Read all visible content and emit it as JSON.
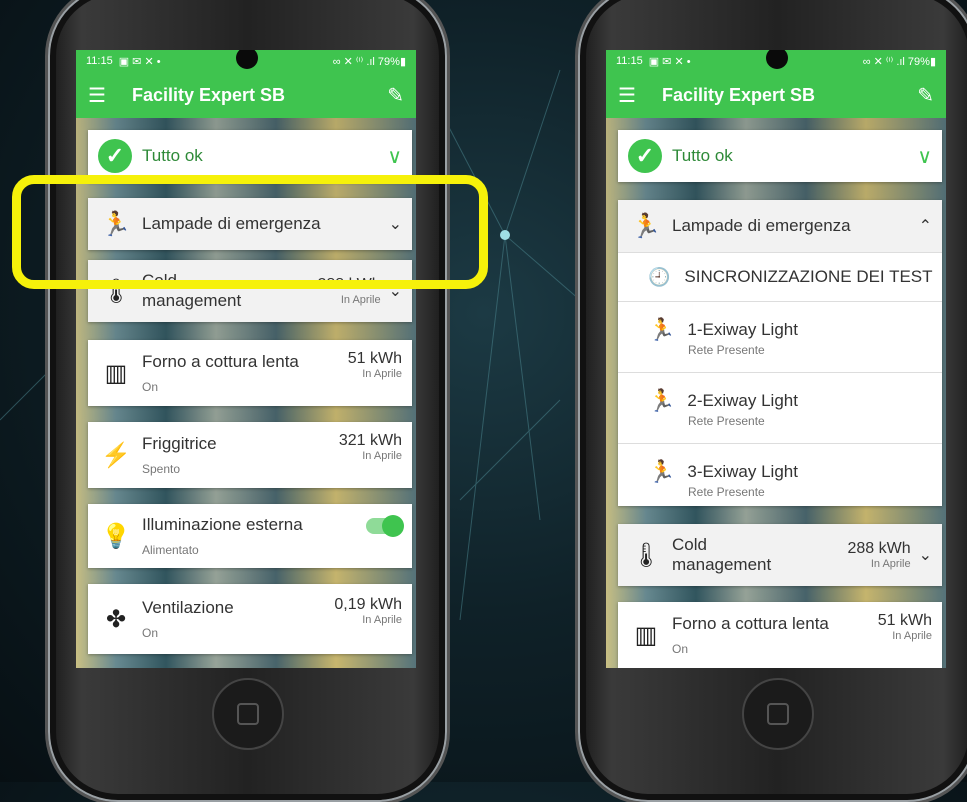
{
  "status_bar": {
    "time": "11:15",
    "icons": "▣ ✉ ✕ •",
    "right": "∞ ✕ ⁽ⁱ⁾ .ıl 79%▮"
  },
  "app": {
    "title": "Facility Expert SB"
  },
  "left": {
    "ok": "Tutto ok",
    "emergency": "Lampade di emergenza",
    "cold": {
      "label_1": "Cold",
      "label_2": "management",
      "value": "288 kWh",
      "meta": "In Aprile"
    },
    "oven": {
      "label": "Forno a cottura lenta",
      "value": "51 kWh",
      "meta": "In Aprile",
      "sub": "On"
    },
    "fryer": {
      "label": "Friggitrice",
      "value": "321 kWh",
      "meta": "In Aprile",
      "sub": "Spento"
    },
    "light": {
      "label": "Illuminazione esterna",
      "sub": "Alimentato"
    },
    "vent": {
      "label": "Ventilazione",
      "value": "0,19 kWh",
      "meta": "In Aprile",
      "sub": "On"
    }
  },
  "right": {
    "ok": "Tutto ok",
    "emergency": "Lampade di emergenza",
    "sync": "SINCRONIZZAZIONE DEI TEST",
    "items": [
      {
        "label": "1-Exiway Light",
        "sub": "Rete Presente"
      },
      {
        "label": "2-Exiway Light",
        "sub": "Rete Presente"
      },
      {
        "label": "3-Exiway Light",
        "sub": "Rete Presente"
      }
    ],
    "cold": {
      "label_1": "Cold",
      "label_2": "management",
      "value": "288 kWh",
      "meta": "In Aprile"
    },
    "oven": {
      "label": "Forno a cottura lenta",
      "value": "51 kWh",
      "meta": "In Aprile",
      "sub": "On"
    }
  },
  "icons": {
    "menu": "☰",
    "edit": "✎",
    "check": "✓",
    "chevron_down": "∨",
    "chevron_small_down": "⌄",
    "chevron_up": "⌃",
    "runner": "🏃",
    "thermo": "🌡",
    "oven": "▥",
    "bolt": "⚡",
    "bulb": "💡",
    "fan": "✤",
    "history": "🕘"
  },
  "colors": {
    "green": "#3fc44f",
    "highlight": "#f6f10a"
  }
}
